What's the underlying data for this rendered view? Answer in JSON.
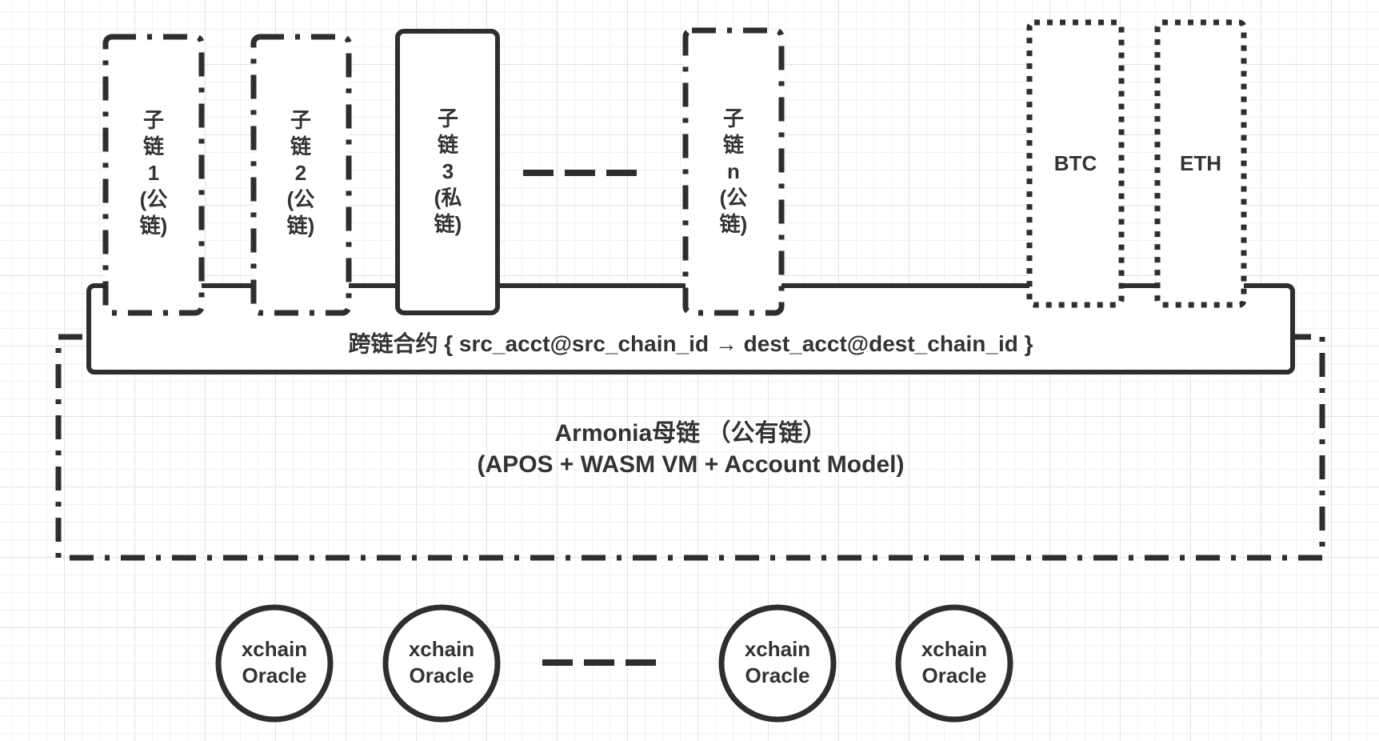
{
  "sub_chains": [
    {
      "text": "子链1(公链)"
    },
    {
      "text": "子链2(公链)"
    },
    {
      "text": "子链3(私链)"
    },
    {
      "text": "子链n(公链)"
    }
  ],
  "external_chains": [
    {
      "text": "BTC"
    },
    {
      "text": "ETH"
    }
  ],
  "cross_chain_contract": {
    "text": "跨链合约 { src_acct@src_chain_id → dest_acct@dest_chain_id }"
  },
  "main_chain": {
    "title": "Armonia母链 （公有链）",
    "subtitle": "(APOS + WASM VM + Account Model)"
  },
  "oracles": [
    {
      "line1": "xchain",
      "line2": "Oracle"
    },
    {
      "line1": "xchain",
      "line2": "Oracle"
    },
    {
      "line1": "xchain",
      "line2": "Oracle"
    },
    {
      "line1": "xchain",
      "line2": "Oracle"
    }
  ],
  "colors": {
    "stroke": "#2e2e2e",
    "text": "#333333",
    "grid": "#e2e2e2"
  }
}
